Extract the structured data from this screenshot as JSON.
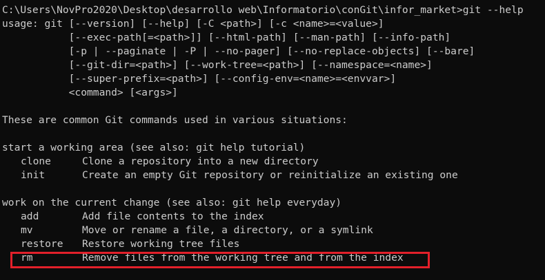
{
  "terminal": {
    "prompt_line": "C:\\Users\\NovPro2020\\Desktop\\desarrollo web\\Informatorio\\conGit\\infor_market>git --help",
    "usage_lines": [
      "usage: git [--version] [--help] [-C <path>] [-c <name>=<value>]",
      "           [--exec-path[=<path>]] [--html-path] [--man-path] [--info-path]",
      "           [-p | --paginate | -P | --no-pager] [--no-replace-objects] [--bare]",
      "           [--git-dir=<path>] [--work-tree=<path>] [--namespace=<name>]",
      "           [--super-prefix=<path>] [--config-env=<name>=<envvar>]",
      "           <command> [<args>]"
    ],
    "intro_text": "These are common Git commands used in various situations:",
    "sections": [
      {
        "heading": "start a working area (see also: git help tutorial)",
        "commands": [
          {
            "name": "clone",
            "desc": "Clone a repository into a new directory"
          },
          {
            "name": "init",
            "desc": "Create an empty Git repository or reinitialize an existing one"
          }
        ]
      },
      {
        "heading": "work on the current change (see also: git help everyday)",
        "commands": [
          {
            "name": "add",
            "desc": "Add file contents to the index"
          },
          {
            "name": "mv",
            "desc": "Move or rename a file, a directory, or a symlink"
          },
          {
            "name": "restore",
            "desc": "Restore working tree files"
          },
          {
            "name": "rm",
            "desc": "Remove files from the working tree and from the index"
          }
        ]
      }
    ]
  },
  "colors": {
    "background": "#0c0c0c",
    "text": "#cccccc",
    "highlight_border": "#e3202a"
  }
}
